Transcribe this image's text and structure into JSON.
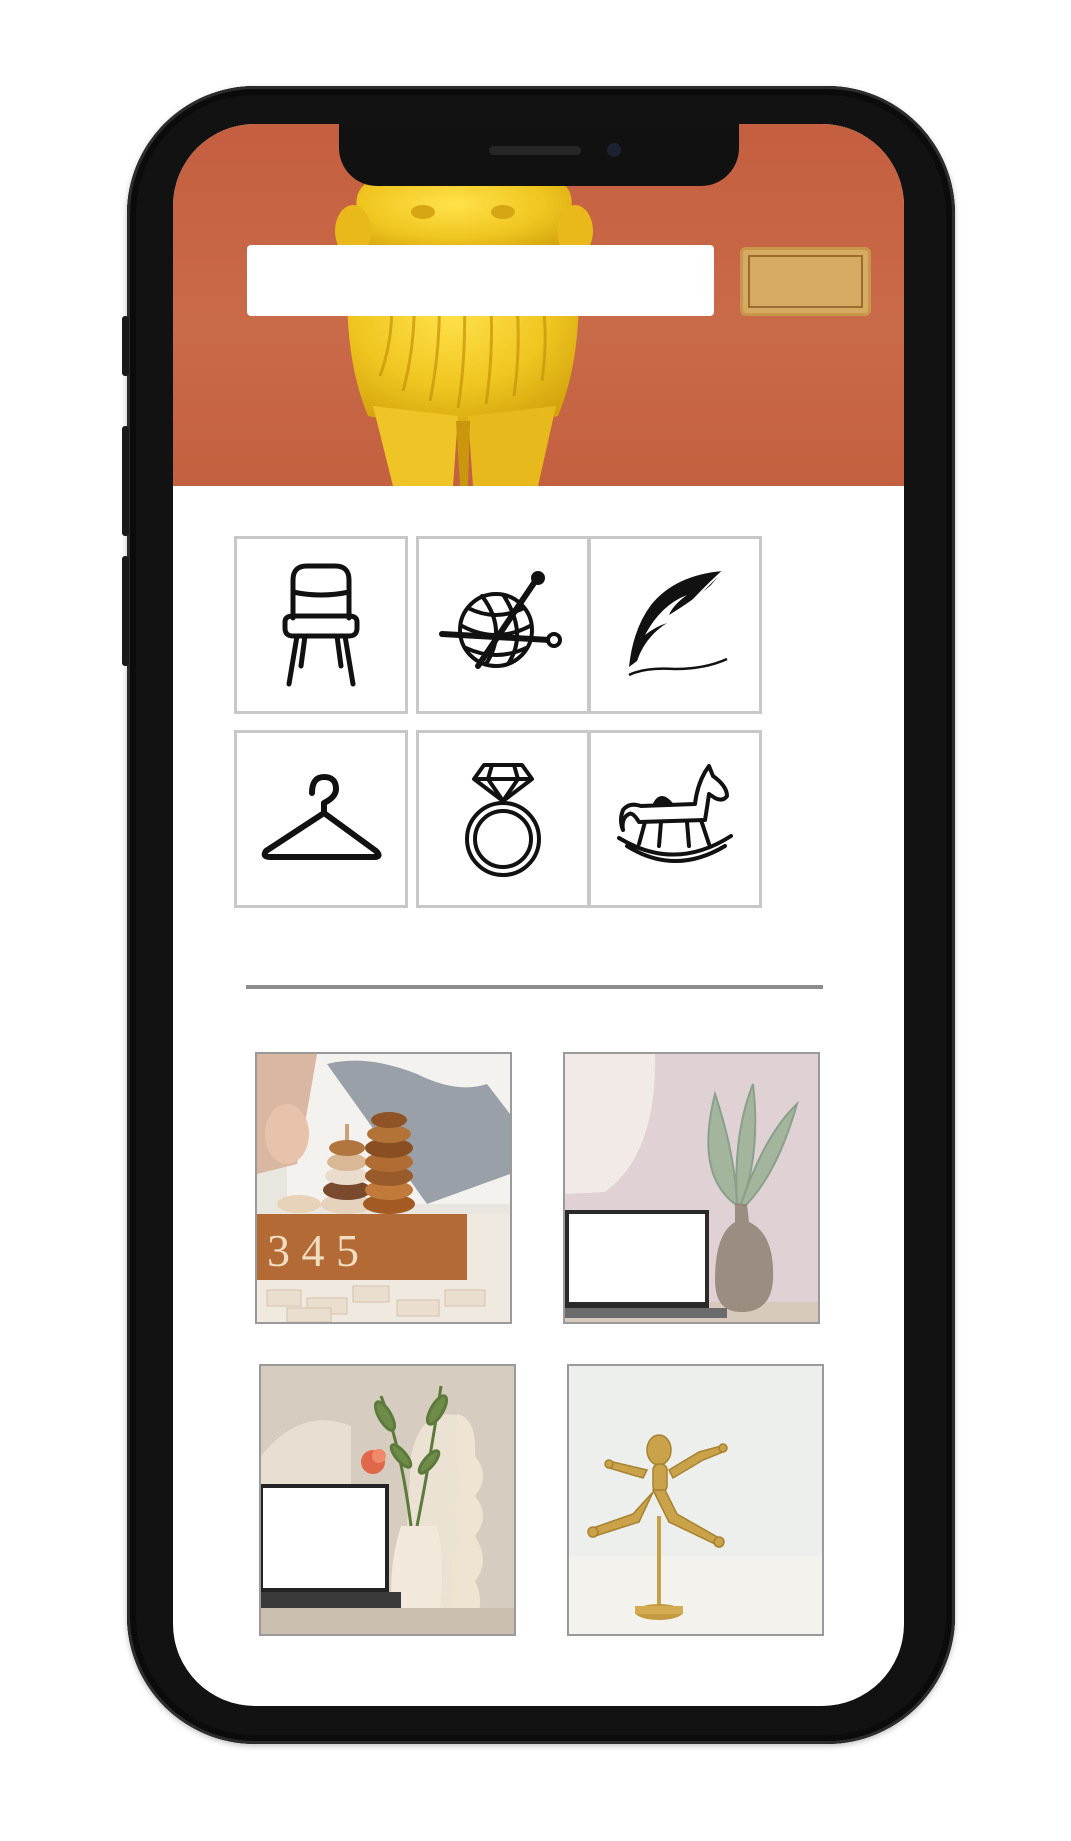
{
  "search": {
    "value": "",
    "placeholder": ""
  },
  "search_button": {
    "label": ""
  },
  "categories": [
    {
      "icon": "chair-icon"
    },
    {
      "icon": "yarn-ball-icon"
    },
    {
      "icon": "feather-quill-icon"
    },
    {
      "icon": "clothes-hanger-icon"
    },
    {
      "icon": "diamond-ring-icon"
    },
    {
      "icon": "rocking-horse-icon"
    }
  ],
  "featured_products": [
    {
      "image": "wooden-stacking-toys"
    },
    {
      "image": "laptop-with-vase"
    },
    {
      "image": "laptop-with-flowers"
    },
    {
      "image": "gold-wooden-mannequin"
    }
  ],
  "colors": {
    "hero_background": "#c4603f",
    "search_button": "#d6aa63",
    "tile_border": "#c8c8c8",
    "divider": "#8c8c8c",
    "phone_frame": "#121212"
  }
}
